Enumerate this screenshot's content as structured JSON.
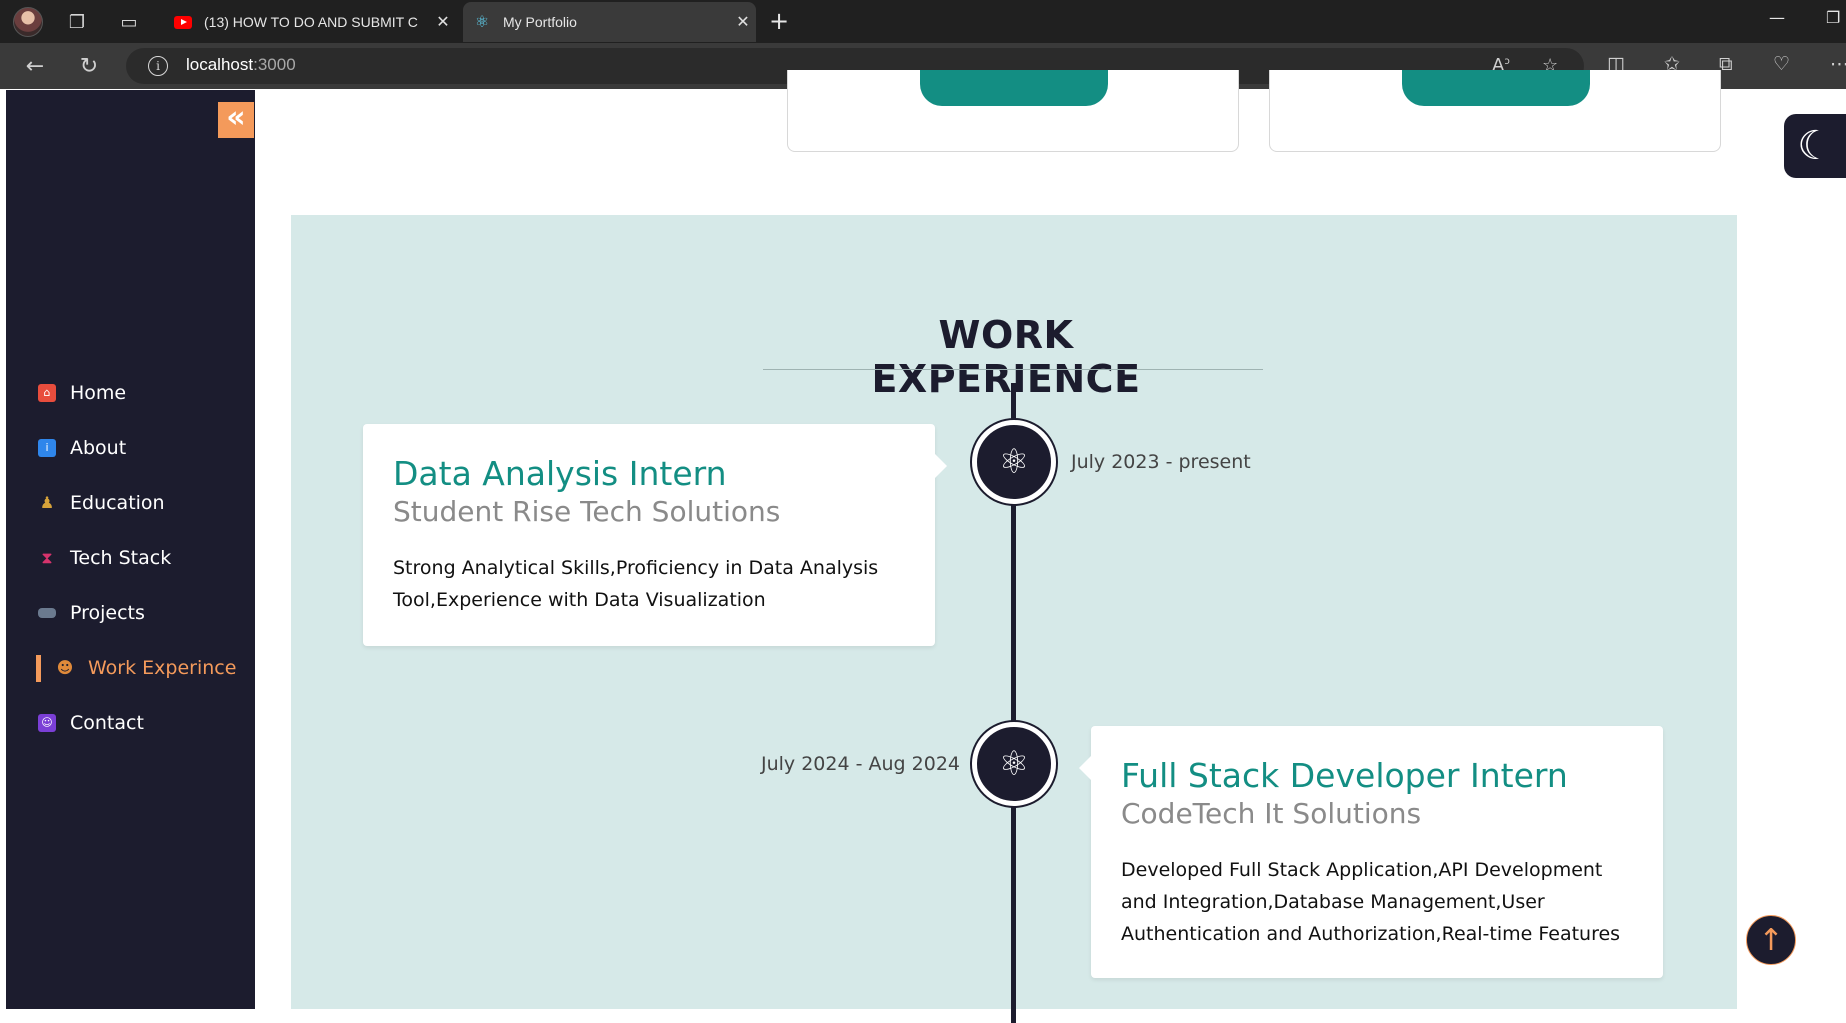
{
  "browser": {
    "tabs": [
      {
        "title": "(13) HOW TO DO AND SUBMIT C",
        "icon": "youtube-icon"
      },
      {
        "title": "My Portfolio",
        "icon": "react-icon"
      }
    ],
    "url_host": "localhost",
    "url_port": ":3000"
  },
  "sidebar": {
    "collapse_icon": "«",
    "items": [
      {
        "label": "Home",
        "icon": "home-icon",
        "color": "#e84d3d"
      },
      {
        "label": "About",
        "icon": "info-icon",
        "color": "#2f86eb"
      },
      {
        "label": "Education",
        "icon": "student-icon",
        "color": "#d6a23a"
      },
      {
        "label": "Tech Stack",
        "icon": "hourglass-icon",
        "color": "#d6336c"
      },
      {
        "label": "Projects",
        "icon": "goggles-icon",
        "color": "#6b7a8f"
      },
      {
        "label": "Work Experince",
        "icon": "worker-icon",
        "color": "#e08a3a"
      },
      {
        "label": "Contact",
        "icon": "contact-icon",
        "color": "#7b3fd6"
      }
    ],
    "active_index": 5
  },
  "main": {
    "section_title": "WORK EXPERIENCE",
    "experiences": [
      {
        "role": "Data Analysis Intern",
        "company": "Student Rise Tech Solutions",
        "description": "Strong Analytical Skills,Proficiency in Data Analysis Tool,Experience with Data Visualization",
        "date": "July 2023 - present"
      },
      {
        "role": "Full Stack Developer Intern",
        "company": "CodeTech It Solutions",
        "description": "Developed Full Stack Application,API Development and Integration,Database Management,User Authentication and Authorization,Real-time Features",
        "date": "July 2024 - Aug 2024"
      }
    ]
  },
  "colors": {
    "accent": "#f49a5b",
    "teal": "#138e83",
    "dark": "#1c1c2e",
    "section_bg": "#d6e9e8"
  }
}
